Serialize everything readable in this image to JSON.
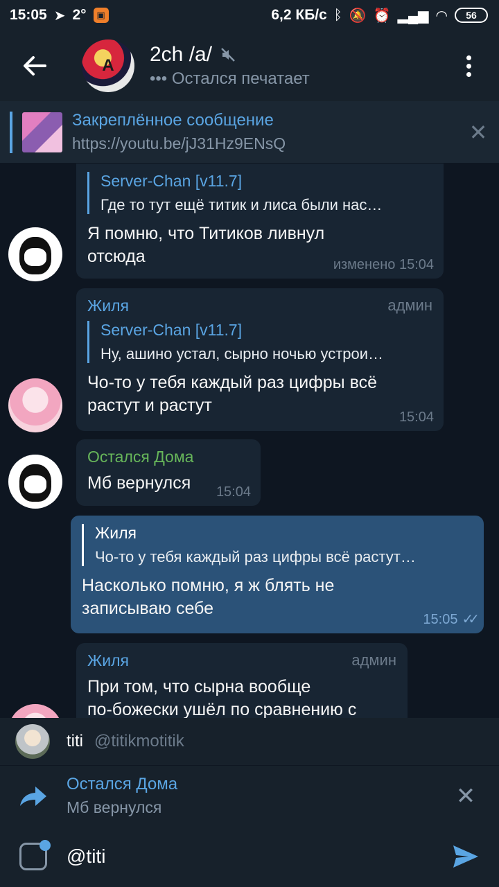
{
  "status_bar": {
    "time": "15:05",
    "temperature": "2°",
    "net_speed": "6,2 КБ/с",
    "battery": "56"
  },
  "header": {
    "title": "2ch /a/",
    "subtitle": "••• Остался печатает",
    "avatar_label": "A"
  },
  "pinned": {
    "title": "Закреплённое сообщение",
    "link": "https://youtu.be/jJ31Hz9ENsQ"
  },
  "messages": [
    {
      "reply_name": "Server-Chan [v11.7]",
      "reply_text": "Где то тут ещё титик и лиса были нас…",
      "text_lines": [
        "Я помню, что Титиков ливнул",
        "отсюда"
      ],
      "time": "изменено 15:04"
    },
    {
      "sender": "Жиля",
      "role": "админ",
      "reply_name": "Server-Chan [v11.7]",
      "reply_text": "Ну, ашино устал, сырно ночью устрои…",
      "text_lines": [
        "Чо-то у тебя каждый раз цифры всё",
        "растут и растут"
      ],
      "time": "15:04"
    },
    {
      "sender": "Остался Дома",
      "text_lines": [
        "Мб вернулся"
      ],
      "time": "15:04"
    },
    {
      "reply_name": "Жиля",
      "reply_text": "Чо-то у тебя каждый раз цифры всё растут…",
      "text_lines": [
        "Насколько помню, я ж блять не",
        "записываю себе"
      ],
      "time": "15:05"
    },
    {
      "sender": "Жиля",
      "role": "админ",
      "text_lines": [
        "При том, что сырна вообще",
        "по-божески ушёл по сравнению с"
      ]
    }
  ],
  "mention": {
    "name": "titi",
    "username": "@titikmotitik"
  },
  "reply_bar": {
    "name": "Остался Дома",
    "text": "Мб вернулся"
  },
  "input": {
    "value": "@titi"
  }
}
